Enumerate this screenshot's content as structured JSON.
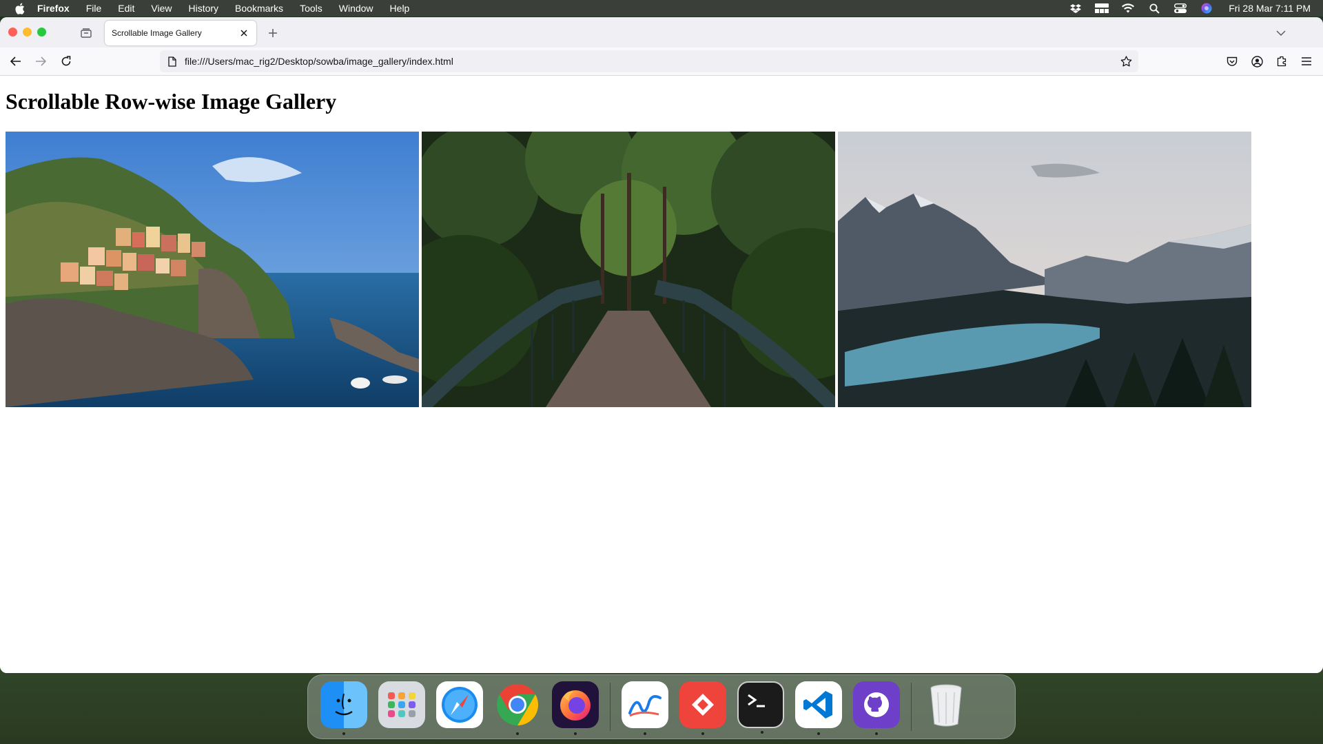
{
  "menubar": {
    "app_name": "Firefox",
    "items": [
      "File",
      "Edit",
      "View",
      "History",
      "Bookmarks",
      "Tools",
      "Window",
      "Help"
    ],
    "status_icons": [
      "dropbox-icon",
      "grid-icon",
      "wifi-icon",
      "search-icon",
      "control-center-icon",
      "siri-icon"
    ],
    "clock": "Fri 28 Mar  7:11 PM"
  },
  "browser": {
    "tab": {
      "title": "Scrollable Image Gallery"
    },
    "url": "file:///Users/mac_rig2/Desktop/sowba/image_gallery/index.html"
  },
  "page": {
    "title": "Scrollable Row-wise Image Gallery",
    "images": [
      {
        "name": "coastal-village-photo",
        "description_icon": "photo"
      },
      {
        "name": "forest-bridge-photo",
        "description_icon": "photo"
      },
      {
        "name": "mountain-lake-photo",
        "description_icon": "photo"
      }
    ]
  },
  "dock": {
    "apps": [
      "Finder",
      "Launchpad",
      "Safari",
      "Google Chrome",
      "Firefox",
      "Freeform",
      "AnyDesk",
      "Terminal",
      "Visual Studio Code",
      "GitHub Desktop",
      "Trash"
    ],
    "colors": {
      "finder": "#1e8ff5",
      "chrome_red": "#ea4335",
      "firefox": "#ff7139",
      "anydesk": "#ef443b",
      "vscode": "#0078d4",
      "github": "#6e40c9"
    }
  }
}
